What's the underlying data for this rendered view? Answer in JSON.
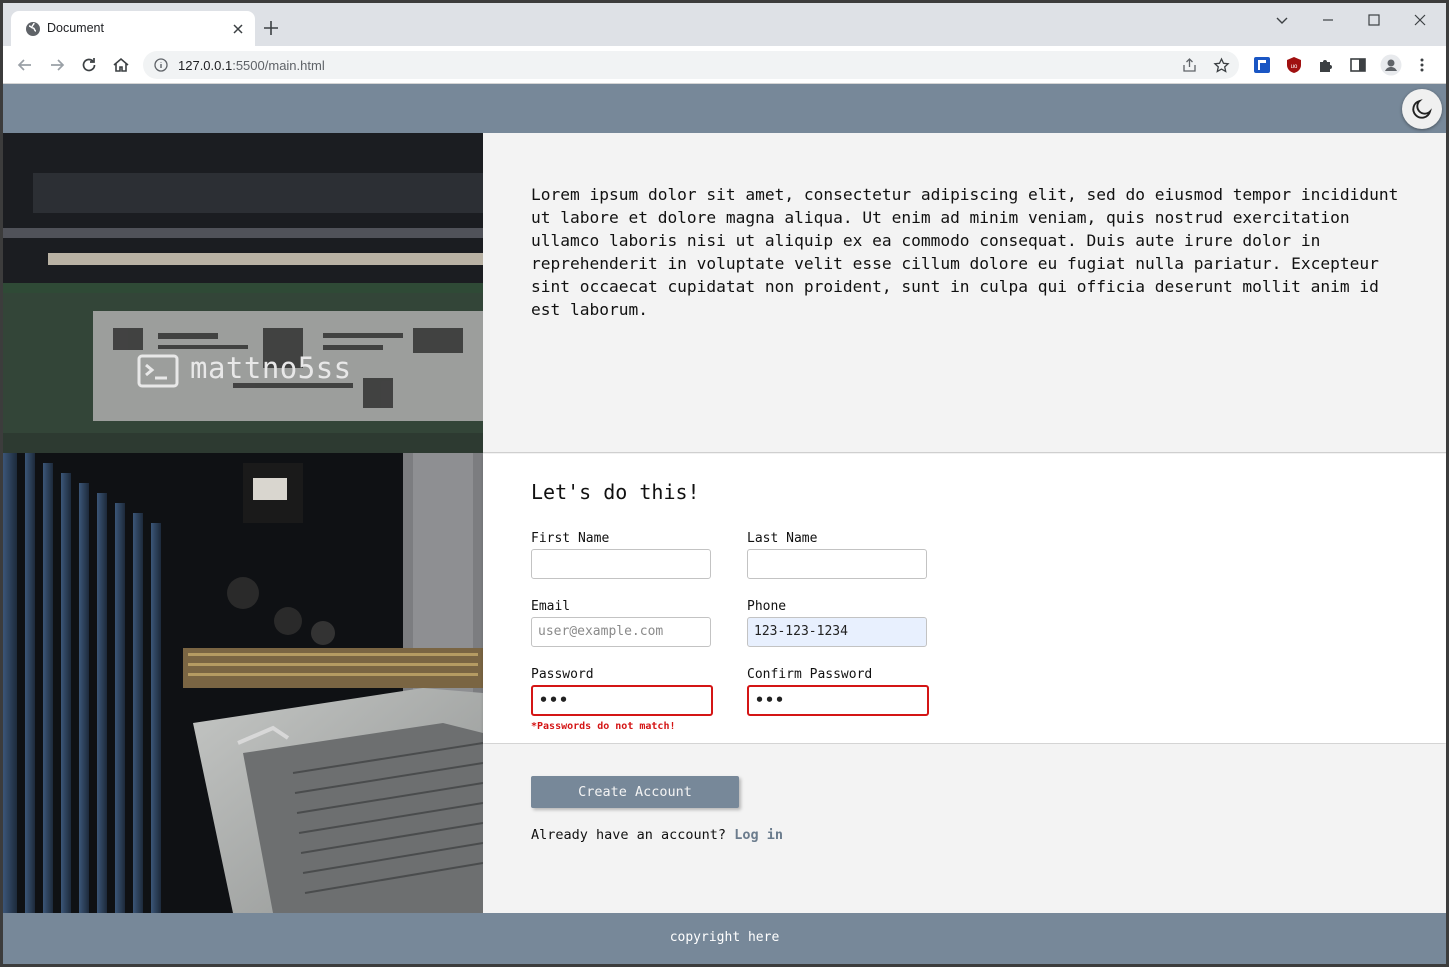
{
  "browser": {
    "tab_title": "Document",
    "url_host": "127.0.0.1",
    "url_rest": ":5500/main.html"
  },
  "site": {
    "brand_name": "mattno5ss",
    "intro_text": "Lorem ipsum dolor sit amet, consectetur adipiscing elit, sed do eiusmod tempor incididunt ut labore et dolore magna aliqua. Ut enim ad minim veniam, quis nostrud exercitation ullamco laboris nisi ut aliquip ex ea commodo consequat. Duis aute irure dolor in reprehenderit in voluptate velit esse cillum dolore eu fugiat nulla pariatur. Excepteur sint occaecat cupidatat non proident, sunt in culpa qui officia deserunt mollit anim id est laborum.",
    "footer_text": "copyright here"
  },
  "form": {
    "heading": "Let's do this!",
    "first_name": {
      "label": "First Name",
      "value": ""
    },
    "last_name": {
      "label": "Last Name",
      "value": ""
    },
    "email": {
      "label": "Email",
      "value": "",
      "placeholder": "user@example.com"
    },
    "phone": {
      "label": "Phone",
      "value": "123-123-1234"
    },
    "password": {
      "label": "Password",
      "value": "•••"
    },
    "confirm_password": {
      "label": "Confirm Password",
      "value": "•••"
    },
    "error_message": "*Passwords do not match!",
    "submit_label": "Create Account",
    "login_prompt": "Already have an account?",
    "login_link": "Log in"
  },
  "colors": {
    "header_bg": "#778899",
    "error": "#d41515",
    "autofill": "#e8f0fe"
  },
  "icons": [
    "globe-icon",
    "close-icon",
    "plus-icon",
    "chevron-down-icon",
    "minimize-icon",
    "maximize-icon",
    "window-close-icon",
    "back-arrow-icon",
    "forward-arrow-icon",
    "reload-icon",
    "home-icon",
    "info-icon",
    "share-icon",
    "star-icon",
    "extension-icon",
    "ublock-icon",
    "puzzle-icon",
    "sidepanel-icon",
    "profile-icon",
    "kebab-menu-icon",
    "moon-icon",
    "terminal-icon"
  ]
}
